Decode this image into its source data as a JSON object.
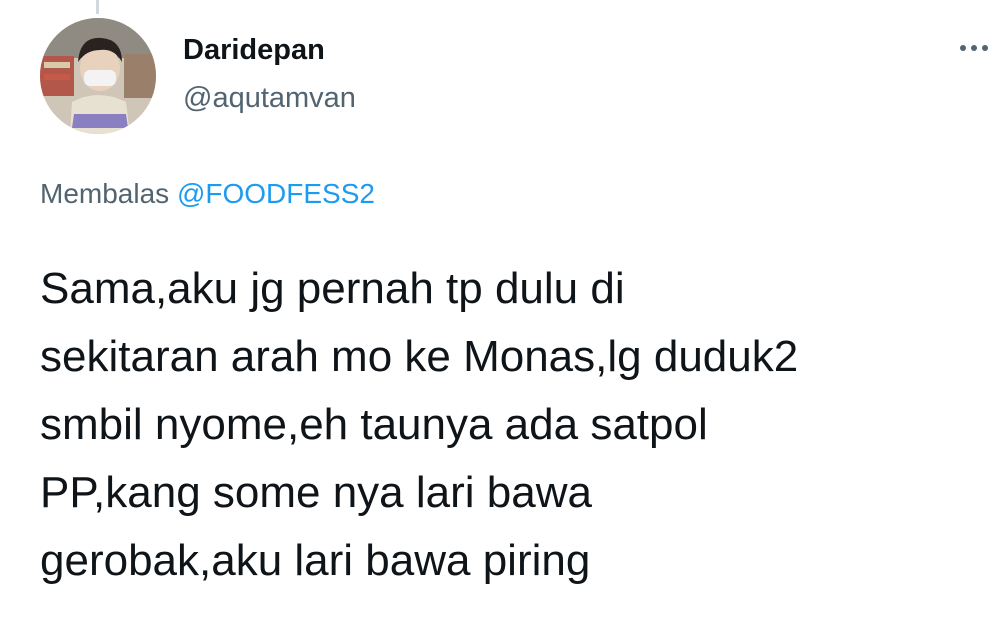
{
  "tweet": {
    "author": {
      "display_name": "Daridepan",
      "handle": "@aqutamvan",
      "avatar_icon": "profile-photo"
    },
    "more_icon": "more-horizontal-icon",
    "reply": {
      "prefix": "Membalas ",
      "mention": "@FOODFESS2"
    },
    "text": "Sama,aku jg pernah tp dulu di\nsekitaran arah mo ke Monas,lg duduk2\nsmbil nyome,eh taunya ada satpol\nPP,kang some nya lari bawa\ngerobak,aku lari bawa piring"
  },
  "colors": {
    "primary_text": "#0f1419",
    "secondary_text": "#536471",
    "link": "#1d9bf0"
  }
}
